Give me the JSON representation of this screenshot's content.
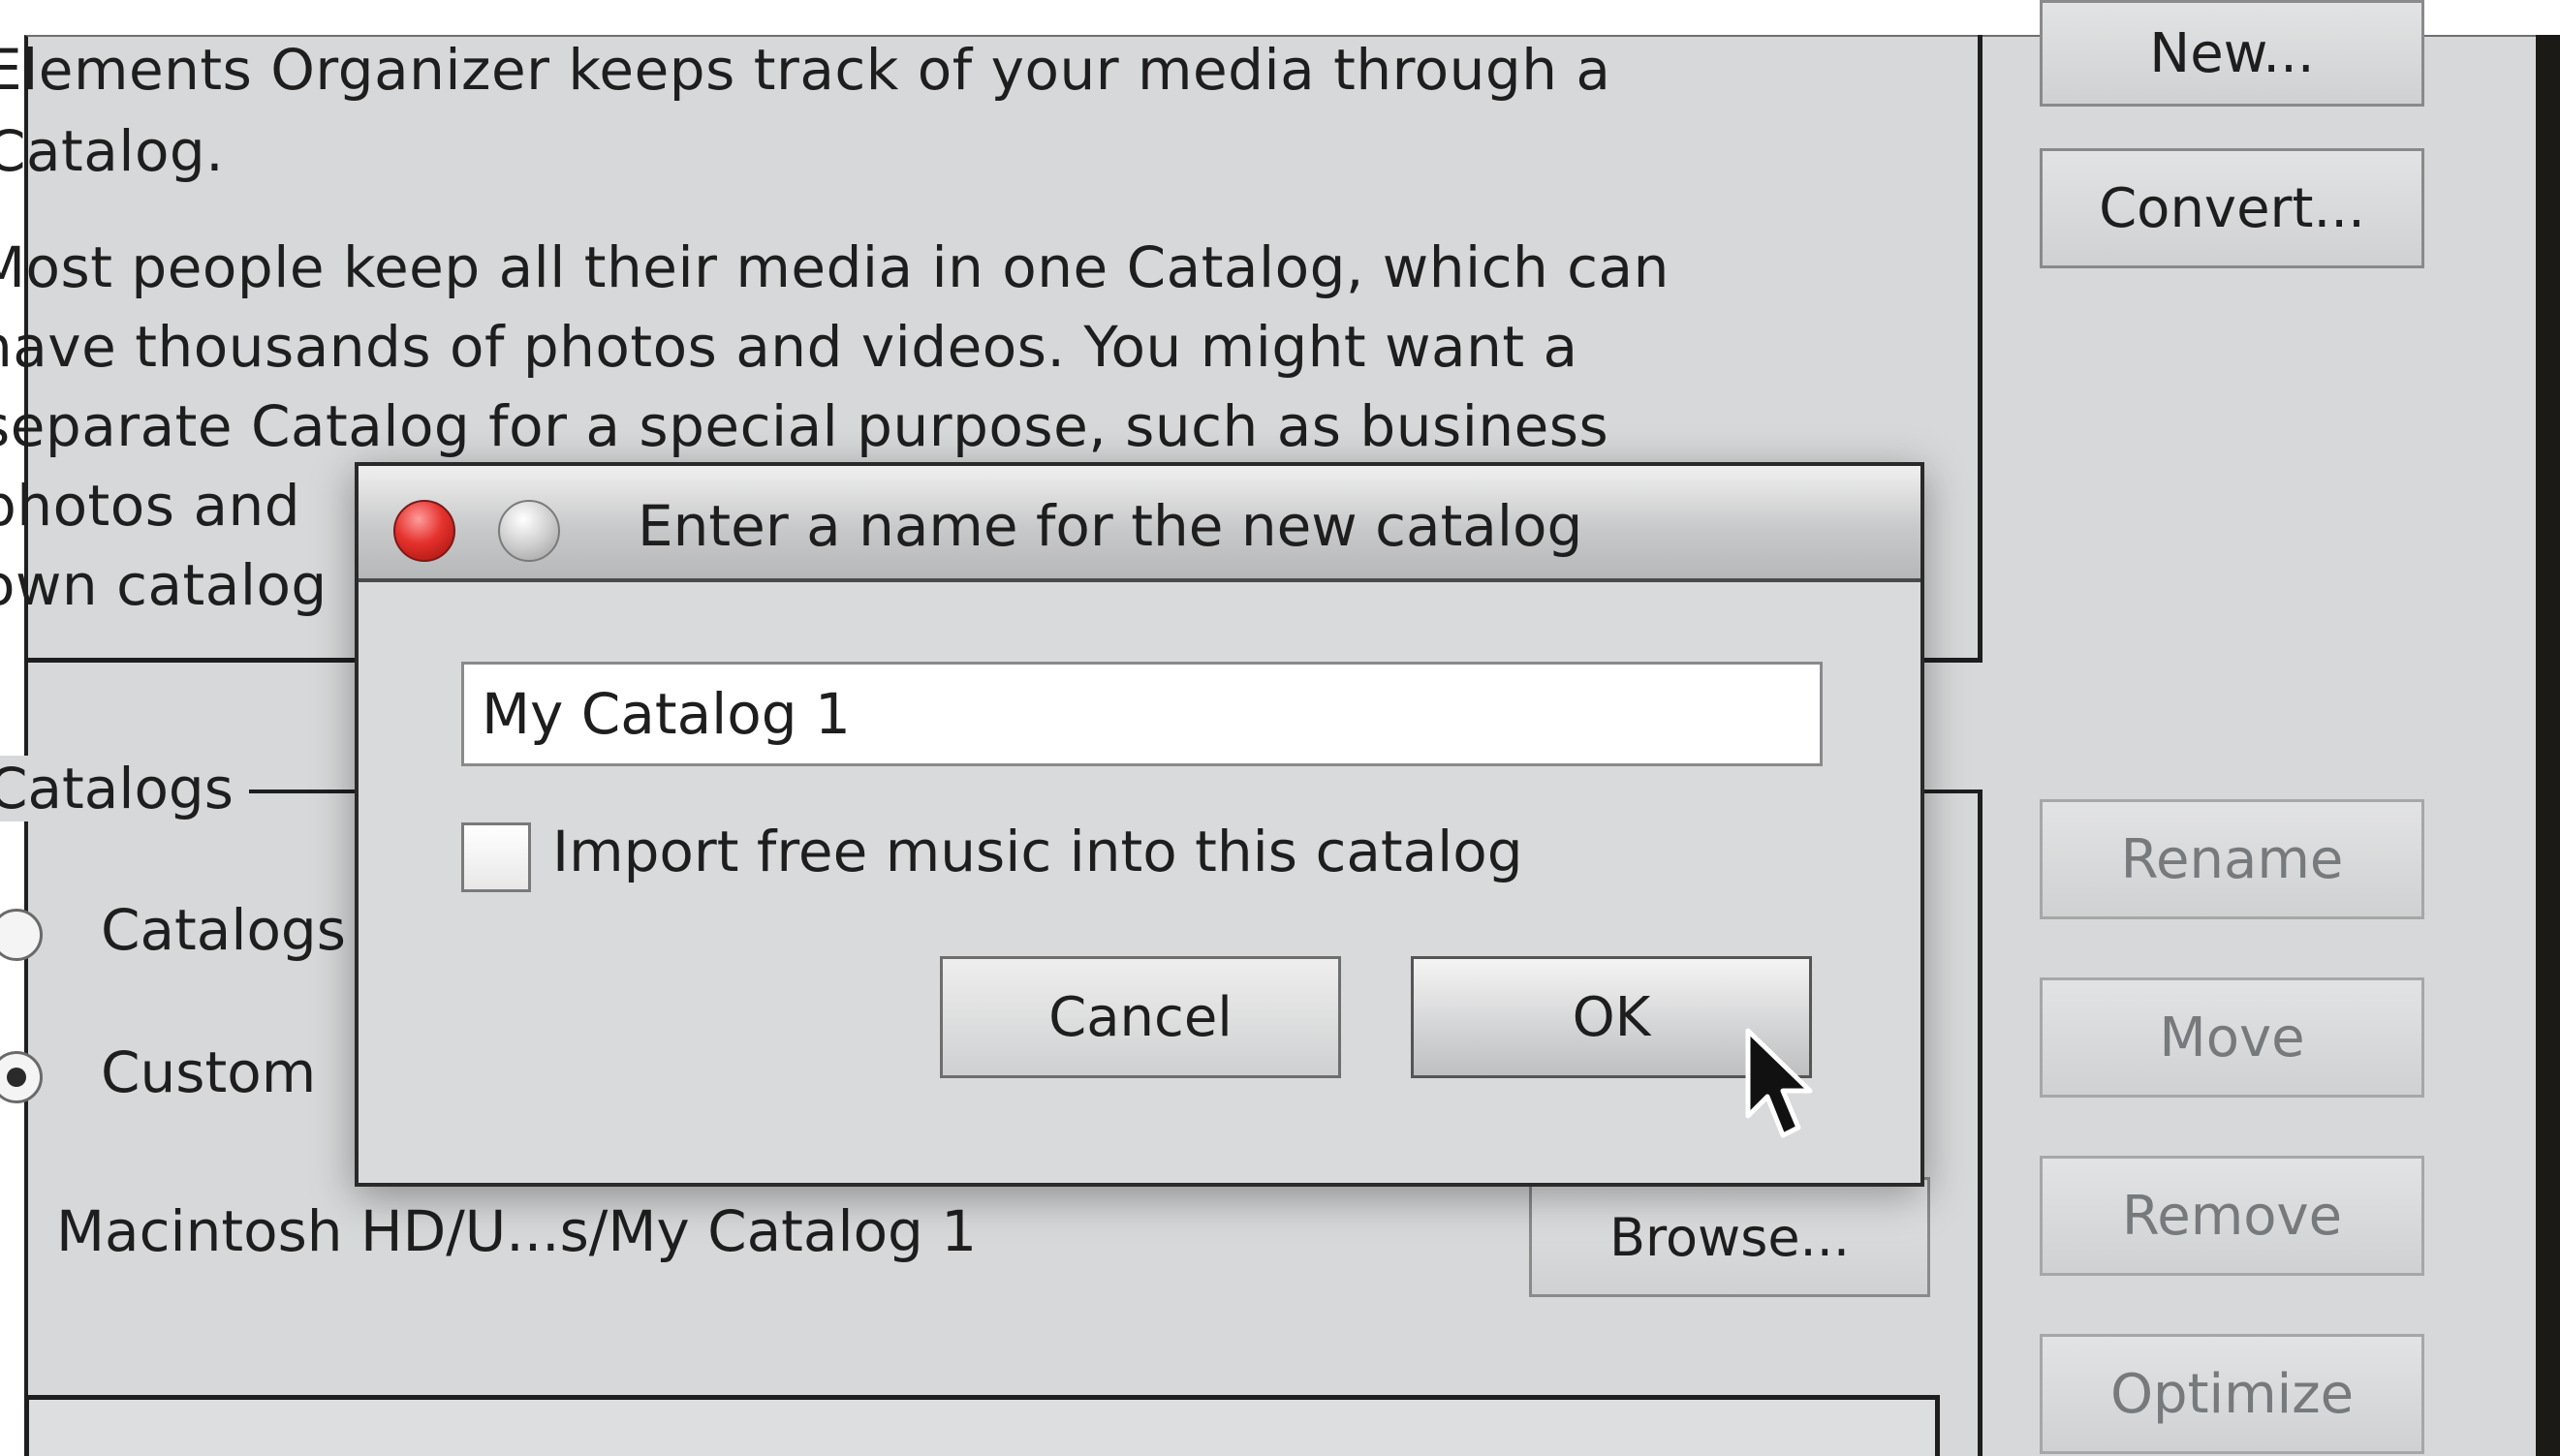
{
  "description": {
    "lines": [
      "Elements Organizer keeps track of your media through a",
      "Catalog.",
      "Most people keep all their media in one Catalog, which can",
      "have thousands of photos and videos. You might want a",
      "separate Catalog for a special purpose, such as business",
      "photos and",
      "own catalog"
    ]
  },
  "side_buttons": {
    "new": "New...",
    "convert": "Convert...",
    "rename": "Rename",
    "move": "Move",
    "remove": "Remove",
    "optimize": "Optimize"
  },
  "catalogs_section": {
    "legend": "Catalogs",
    "radio_option_1": "Catalogs",
    "radio_option_2": "Custom",
    "path": "Macintosh HD/U...s/My Catalog 1",
    "browse": "Browse..."
  },
  "dialog": {
    "title": "Enter a name for the new catalog",
    "name_value": "My Catalog 1",
    "checkbox_label": "Import free music into this catalog",
    "checkbox_checked": false,
    "cancel": "Cancel",
    "ok": "OK"
  }
}
